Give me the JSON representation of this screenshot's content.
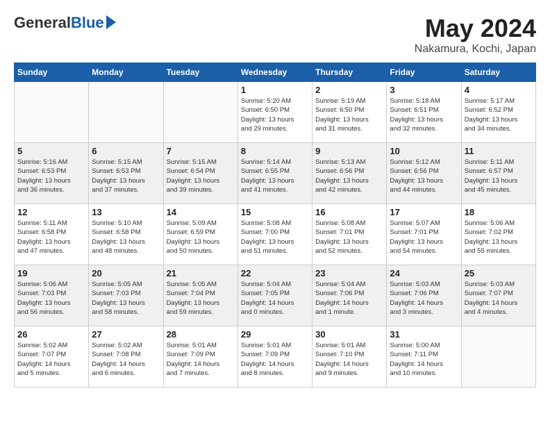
{
  "logo": {
    "general": "General",
    "blue": "Blue"
  },
  "title": "May 2024",
  "location": "Nakamura, Kochi, Japan",
  "days_of_week": [
    "Sunday",
    "Monday",
    "Tuesday",
    "Wednesday",
    "Thursday",
    "Friday",
    "Saturday"
  ],
  "weeks": [
    [
      {
        "num": "",
        "info": ""
      },
      {
        "num": "",
        "info": ""
      },
      {
        "num": "",
        "info": ""
      },
      {
        "num": "1",
        "info": "Sunrise: 5:20 AM\nSunset: 6:50 PM\nDaylight: 13 hours\nand 29 minutes."
      },
      {
        "num": "2",
        "info": "Sunrise: 5:19 AM\nSunset: 6:50 PM\nDaylight: 13 hours\nand 31 minutes."
      },
      {
        "num": "3",
        "info": "Sunrise: 5:18 AM\nSunset: 6:51 PM\nDaylight: 13 hours\nand 32 minutes."
      },
      {
        "num": "4",
        "info": "Sunrise: 5:17 AM\nSunset: 6:52 PM\nDaylight: 13 hours\nand 34 minutes."
      }
    ],
    [
      {
        "num": "5",
        "info": "Sunrise: 5:16 AM\nSunset: 6:53 PM\nDaylight: 13 hours\nand 36 minutes."
      },
      {
        "num": "6",
        "info": "Sunrise: 5:15 AM\nSunset: 6:53 PM\nDaylight: 13 hours\nand 37 minutes."
      },
      {
        "num": "7",
        "info": "Sunrise: 5:15 AM\nSunset: 6:54 PM\nDaylight: 13 hours\nand 39 minutes."
      },
      {
        "num": "8",
        "info": "Sunrise: 5:14 AM\nSunset: 6:55 PM\nDaylight: 13 hours\nand 41 minutes."
      },
      {
        "num": "9",
        "info": "Sunrise: 5:13 AM\nSunset: 6:56 PM\nDaylight: 13 hours\nand 42 minutes."
      },
      {
        "num": "10",
        "info": "Sunrise: 5:12 AM\nSunset: 6:56 PM\nDaylight: 13 hours\nand 44 minutes."
      },
      {
        "num": "11",
        "info": "Sunrise: 5:11 AM\nSunset: 6:57 PM\nDaylight: 13 hours\nand 45 minutes."
      }
    ],
    [
      {
        "num": "12",
        "info": "Sunrise: 5:11 AM\nSunset: 6:58 PM\nDaylight: 13 hours\nand 47 minutes."
      },
      {
        "num": "13",
        "info": "Sunrise: 5:10 AM\nSunset: 6:58 PM\nDaylight: 13 hours\nand 48 minutes."
      },
      {
        "num": "14",
        "info": "Sunrise: 5:09 AM\nSunset: 6:59 PM\nDaylight: 13 hours\nand 50 minutes."
      },
      {
        "num": "15",
        "info": "Sunrise: 5:08 AM\nSunset: 7:00 PM\nDaylight: 13 hours\nand 51 minutes."
      },
      {
        "num": "16",
        "info": "Sunrise: 5:08 AM\nSunset: 7:01 PM\nDaylight: 13 hours\nand 52 minutes."
      },
      {
        "num": "17",
        "info": "Sunrise: 5:07 AM\nSunset: 7:01 PM\nDaylight: 13 hours\nand 54 minutes."
      },
      {
        "num": "18",
        "info": "Sunrise: 5:06 AM\nSunset: 7:02 PM\nDaylight: 13 hours\nand 55 minutes."
      }
    ],
    [
      {
        "num": "19",
        "info": "Sunrise: 5:06 AM\nSunset: 7:03 PM\nDaylight: 13 hours\nand 56 minutes."
      },
      {
        "num": "20",
        "info": "Sunrise: 5:05 AM\nSunset: 7:03 PM\nDaylight: 13 hours\nand 58 minutes."
      },
      {
        "num": "21",
        "info": "Sunrise: 5:05 AM\nSunset: 7:04 PM\nDaylight: 13 hours\nand 59 minutes."
      },
      {
        "num": "22",
        "info": "Sunrise: 5:04 AM\nSunset: 7:05 PM\nDaylight: 14 hours\nand 0 minutes."
      },
      {
        "num": "23",
        "info": "Sunrise: 5:04 AM\nSunset: 7:06 PM\nDaylight: 14 hours\nand 1 minute."
      },
      {
        "num": "24",
        "info": "Sunrise: 5:03 AM\nSunset: 7:06 PM\nDaylight: 14 hours\nand 3 minutes."
      },
      {
        "num": "25",
        "info": "Sunrise: 5:03 AM\nSunset: 7:07 PM\nDaylight: 14 hours\nand 4 minutes."
      }
    ],
    [
      {
        "num": "26",
        "info": "Sunrise: 5:02 AM\nSunset: 7:07 PM\nDaylight: 14 hours\nand 5 minutes."
      },
      {
        "num": "27",
        "info": "Sunrise: 5:02 AM\nSunset: 7:08 PM\nDaylight: 14 hours\nand 6 minutes."
      },
      {
        "num": "28",
        "info": "Sunrise: 5:01 AM\nSunset: 7:09 PM\nDaylight: 14 hours\nand 7 minutes."
      },
      {
        "num": "29",
        "info": "Sunrise: 5:01 AM\nSunset: 7:09 PM\nDaylight: 14 hours\nand 8 minutes."
      },
      {
        "num": "30",
        "info": "Sunrise: 5:01 AM\nSunset: 7:10 PM\nDaylight: 14 hours\nand 9 minutes."
      },
      {
        "num": "31",
        "info": "Sunrise: 5:00 AM\nSunset: 7:11 PM\nDaylight: 14 hours\nand 10 minutes."
      },
      {
        "num": "",
        "info": ""
      }
    ]
  ]
}
